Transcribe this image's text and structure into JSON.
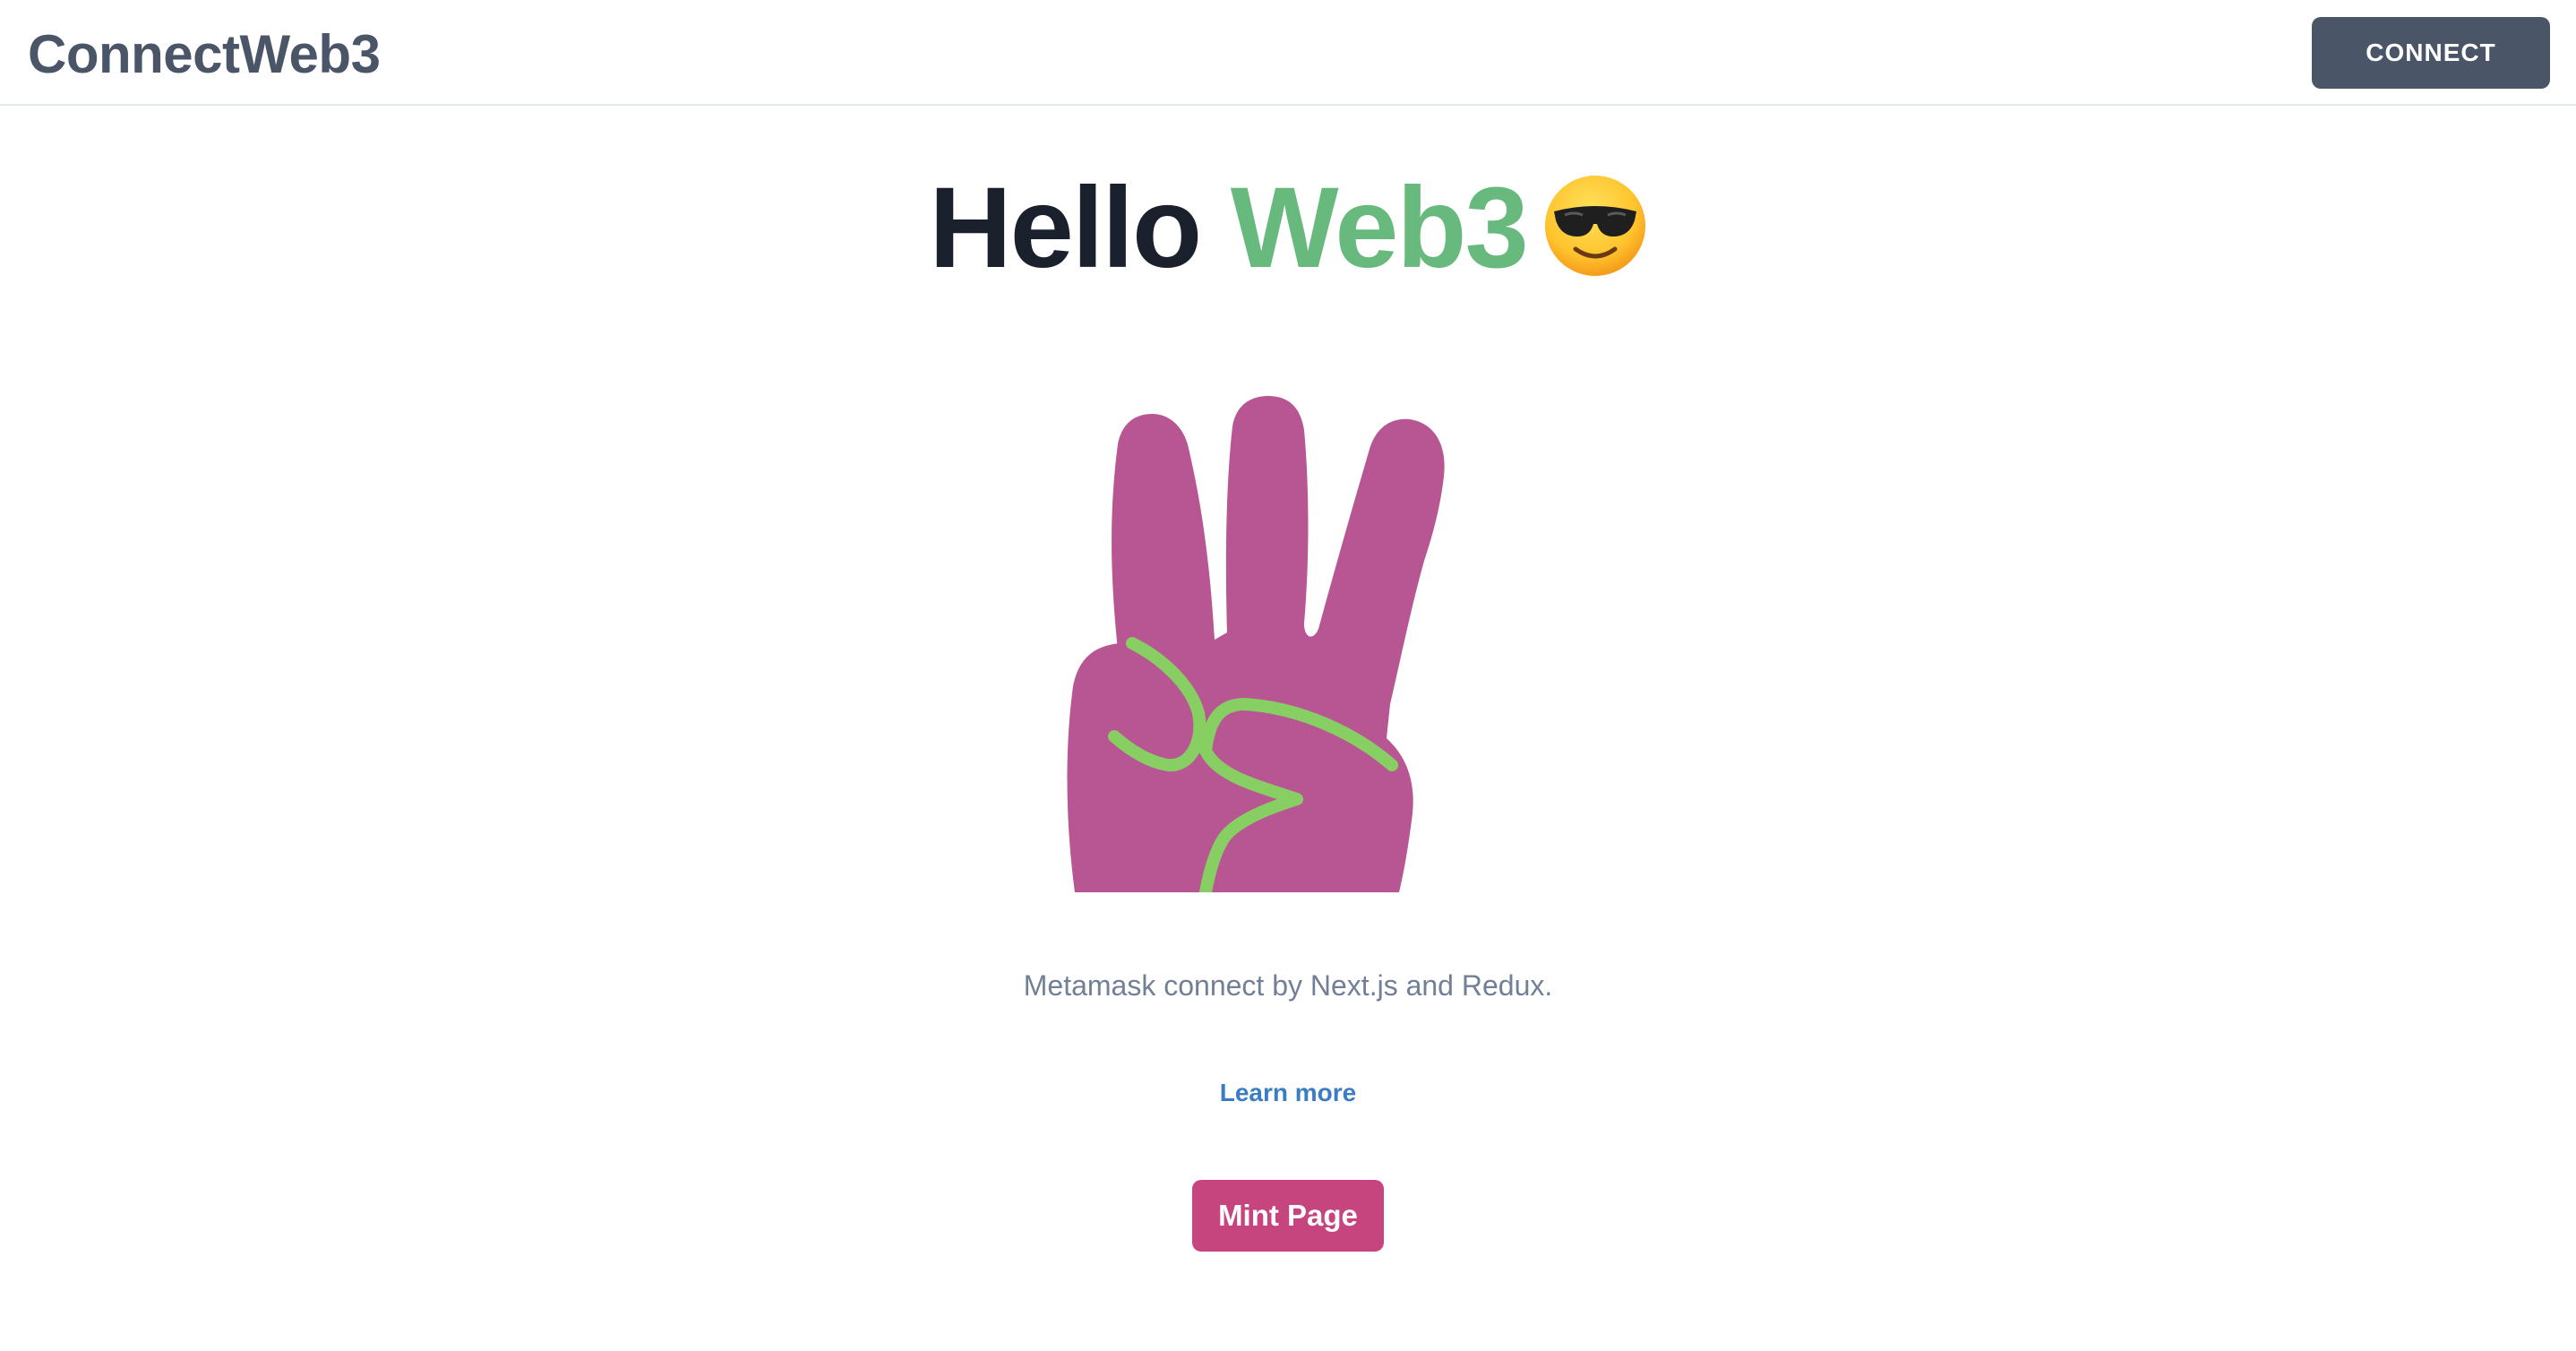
{
  "header": {
    "brand": "ConnectWeb3",
    "connect_label": "CONNECT"
  },
  "hero": {
    "title_part1": "Hello",
    "title_part2": "Web3",
    "emoji_icon": "smiling-face-with-sunglasses-icon",
    "accent_color": "#68b97e",
    "illustration_icon": "three-finger-web3-hand-icon",
    "hand_color": "#b85593",
    "stroke_color": "#88cf63"
  },
  "content": {
    "subtitle": "Metamask connect by Next.js and Redux.",
    "learn_more": "Learn more",
    "mint_label": "Mint Page"
  },
  "colors": {
    "nav_button": "#4a5568",
    "mint_button": "#c6457e",
    "link": "#3b7dc4"
  }
}
